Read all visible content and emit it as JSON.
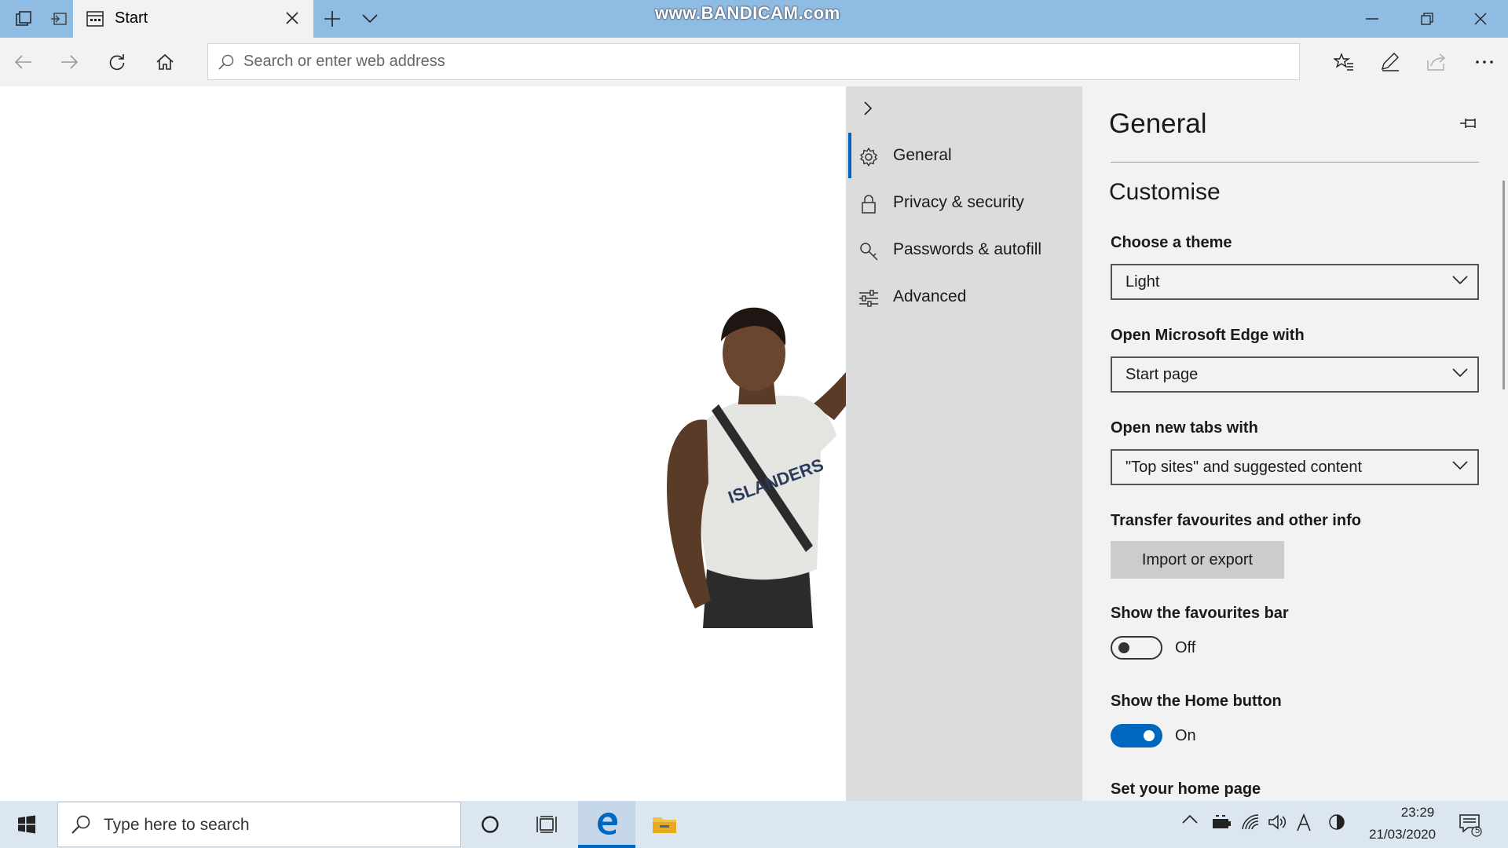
{
  "browser": {
    "tab_title": "Start",
    "address_placeholder": "Search or enter web address",
    "watermark": "www.BANDICAM.com"
  },
  "settings_nav": {
    "items": [
      {
        "label": "General",
        "icon": "gear-icon",
        "active": true
      },
      {
        "label": "Privacy & security",
        "icon": "lock-icon"
      },
      {
        "label": "Passwords & autofill",
        "icon": "key-icon"
      },
      {
        "label": "Advanced",
        "icon": "sliders-icon"
      }
    ]
  },
  "settings": {
    "title": "General",
    "section": "Customise",
    "theme_label": "Choose a theme",
    "theme_value": "Light",
    "open_with_label": "Open Microsoft Edge with",
    "open_with_value": "Start page",
    "new_tabs_label": "Open new tabs with",
    "new_tabs_value": "\"Top sites\" and suggested content",
    "transfer_label": "Transfer favourites and other info",
    "import_button": "Import or export",
    "fav_bar_label": "Show the favourites bar",
    "fav_bar_state": "Off",
    "home_button_label": "Show the Home button",
    "home_button_state": "On",
    "home_page_label": "Set your home page"
  },
  "taskbar": {
    "search_placeholder": "Type here to search",
    "time": "23:29",
    "date": "21/03/2020",
    "notification_count": "5"
  },
  "colors": {
    "accent": "#0067c0",
    "titlebar": "#8fbce3",
    "settings_nav_bg": "#dcdcdc",
    "settings_panel_bg": "#f2f2f2"
  }
}
